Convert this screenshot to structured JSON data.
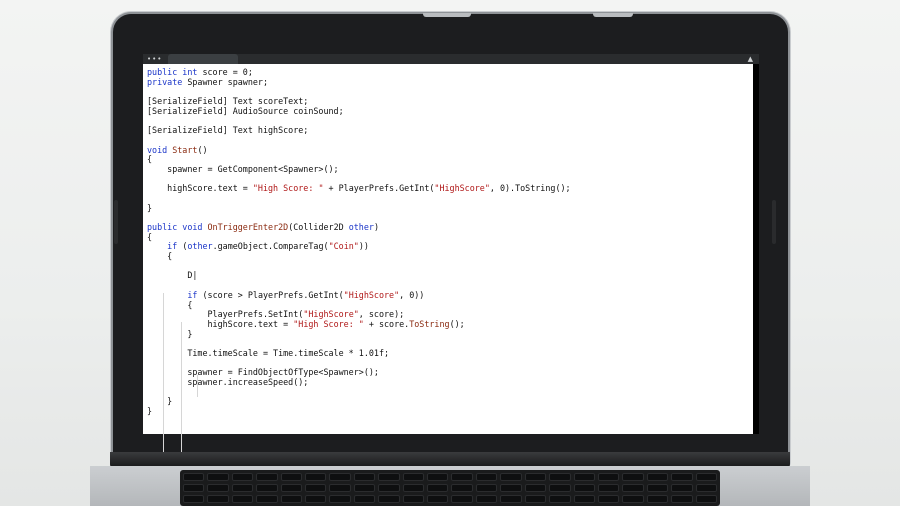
{
  "window": {
    "dots": "•••",
    "notification_icon": "bell-icon"
  },
  "code_lines": [
    {
      "segments": [
        [
          "kw",
          "public "
        ],
        [
          "kw",
          "int "
        ],
        [
          "t",
          "score = 0;"
        ]
      ]
    },
    {
      "segments": [
        [
          "kw",
          "private "
        ],
        [
          "t",
          "Spawner spawner;"
        ]
      ]
    },
    {
      "segments": [
        [
          "t",
          ""
        ]
      ]
    },
    {
      "segments": [
        [
          "t",
          "[SerializeField] Text scoreText;"
        ]
      ]
    },
    {
      "segments": [
        [
          "t",
          "[SerializeField] AudioSource coinSound;"
        ]
      ]
    },
    {
      "segments": [
        [
          "t",
          ""
        ]
      ]
    },
    {
      "segments": [
        [
          "t",
          "[SerializeField] Text highScore;"
        ]
      ]
    },
    {
      "segments": [
        [
          "t",
          ""
        ]
      ]
    },
    {
      "segments": [
        [
          "kw",
          "void "
        ],
        [
          "fn",
          "Start"
        ],
        [
          "t",
          "()"
        ]
      ]
    },
    {
      "segments": [
        [
          "t",
          "{"
        ]
      ]
    },
    {
      "segments": [
        [
          "t",
          "    spawner = GetComponent<Spawner>();"
        ]
      ]
    },
    {
      "segments": [
        [
          "t",
          ""
        ]
      ]
    },
    {
      "segments": [
        [
          "t",
          "    highScore.text = "
        ],
        [
          "str",
          "\"High Score: \""
        ],
        [
          "t",
          " + PlayerPrefs.GetInt("
        ],
        [
          "str",
          "\"HighScore\""
        ],
        [
          "t",
          ", 0).ToString();"
        ]
      ]
    },
    {
      "segments": [
        [
          "t",
          ""
        ]
      ]
    },
    {
      "segments": [
        [
          "t",
          "}"
        ]
      ]
    },
    {
      "segments": [
        [
          "t",
          ""
        ]
      ]
    },
    {
      "segments": [
        [
          "kw",
          "public "
        ],
        [
          "kw",
          "void "
        ],
        [
          "fn",
          "OnTriggerEnter2D"
        ],
        [
          "t",
          "(Collider2D "
        ],
        [
          "kw",
          "other"
        ],
        [
          "t",
          ")"
        ]
      ]
    },
    {
      "segments": [
        [
          "t",
          "{"
        ]
      ]
    },
    {
      "segments": [
        [
          "t",
          "    "
        ],
        [
          "kw",
          "if "
        ],
        [
          "t",
          "("
        ],
        [
          "kw",
          "other"
        ],
        [
          "t",
          ".gameObject.CompareTag("
        ],
        [
          "str",
          "\"Coin\""
        ],
        [
          "t",
          "))"
        ]
      ]
    },
    {
      "segments": [
        [
          "t",
          "    {"
        ]
      ]
    },
    {
      "segments": [
        [
          "t",
          ""
        ]
      ]
    },
    {
      "segments": [
        [
          "t",
          "        D|"
        ]
      ]
    },
    {
      "segments": [
        [
          "t",
          ""
        ]
      ]
    },
    {
      "segments": [
        [
          "t",
          "        "
        ],
        [
          "kw",
          "if "
        ],
        [
          "t",
          "(score > PlayerPrefs.GetInt("
        ],
        [
          "str",
          "\"HighScore\""
        ],
        [
          "t",
          ", 0))"
        ]
      ]
    },
    {
      "segments": [
        [
          "t",
          "        {"
        ]
      ]
    },
    {
      "segments": [
        [
          "t",
          "            PlayerPrefs.SetInt("
        ],
        [
          "str",
          "\"HighScore\""
        ],
        [
          "t",
          ", score);"
        ]
      ]
    },
    {
      "segments": [
        [
          "t",
          "            highScore.text = "
        ],
        [
          "str",
          "\"High Score: \""
        ],
        [
          "t",
          " + score."
        ],
        [
          "fn",
          "ToString"
        ],
        [
          "t",
          "();"
        ]
      ]
    },
    {
      "segments": [
        [
          "t",
          "        }"
        ]
      ]
    },
    {
      "segments": [
        [
          "t",
          ""
        ]
      ]
    },
    {
      "segments": [
        [
          "t",
          "        Time.timeScale = Time.timeScale * 1.01f;"
        ]
      ]
    },
    {
      "segments": [
        [
          "t",
          ""
        ]
      ]
    },
    {
      "segments": [
        [
          "t",
          "        spawner = FindObjectOfType<Spawner>();"
        ]
      ]
    },
    {
      "segments": [
        [
          "t",
          "        spawner.increaseSpeed();"
        ]
      ]
    },
    {
      "segments": [
        [
          "t",
          ""
        ]
      ]
    },
    {
      "segments": [
        [
          "t",
          "    }"
        ]
      ]
    },
    {
      "segments": [
        [
          "t",
          "}"
        ]
      ]
    }
  ],
  "colors": {
    "keyword": "#1a34c8",
    "string": "#b01818",
    "method": "#8a2a10",
    "text": "#111111",
    "editor_background": "#ffffff"
  }
}
